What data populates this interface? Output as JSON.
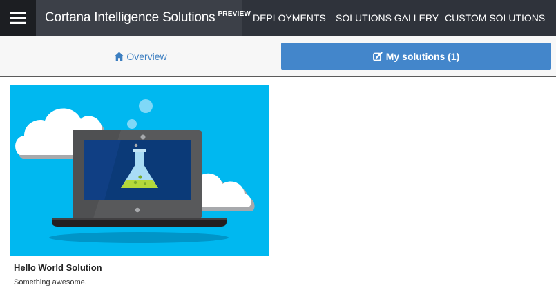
{
  "navbar": {
    "menu_icon": "hamburger-menu-icon",
    "brand": "Cortana Intelligence Solutions",
    "brand_badge": "PREVIEW",
    "links": [
      "DEPLOYMENTS",
      "SOLUTIONS GALLERY",
      "CUSTOM SOLUTIONS"
    ]
  },
  "tabs": {
    "overview": {
      "label": "Overview",
      "icon": "home-icon"
    },
    "my_solutions": {
      "label": "My solutions (1)",
      "icon": "edit-square-icon"
    }
  },
  "solutions": [
    {
      "title": "Hello World Solution",
      "description": "Something awesome.",
      "image": "laptop-flask-illustration"
    }
  ],
  "colors": {
    "navbar_bg": "#2f333b",
    "brand_bg": "#3c4048",
    "menu_bg": "#1c1e22",
    "accent_blue": "#4386cb",
    "link_blue": "#3d7fc1",
    "card_sky": "#00b8f0"
  }
}
